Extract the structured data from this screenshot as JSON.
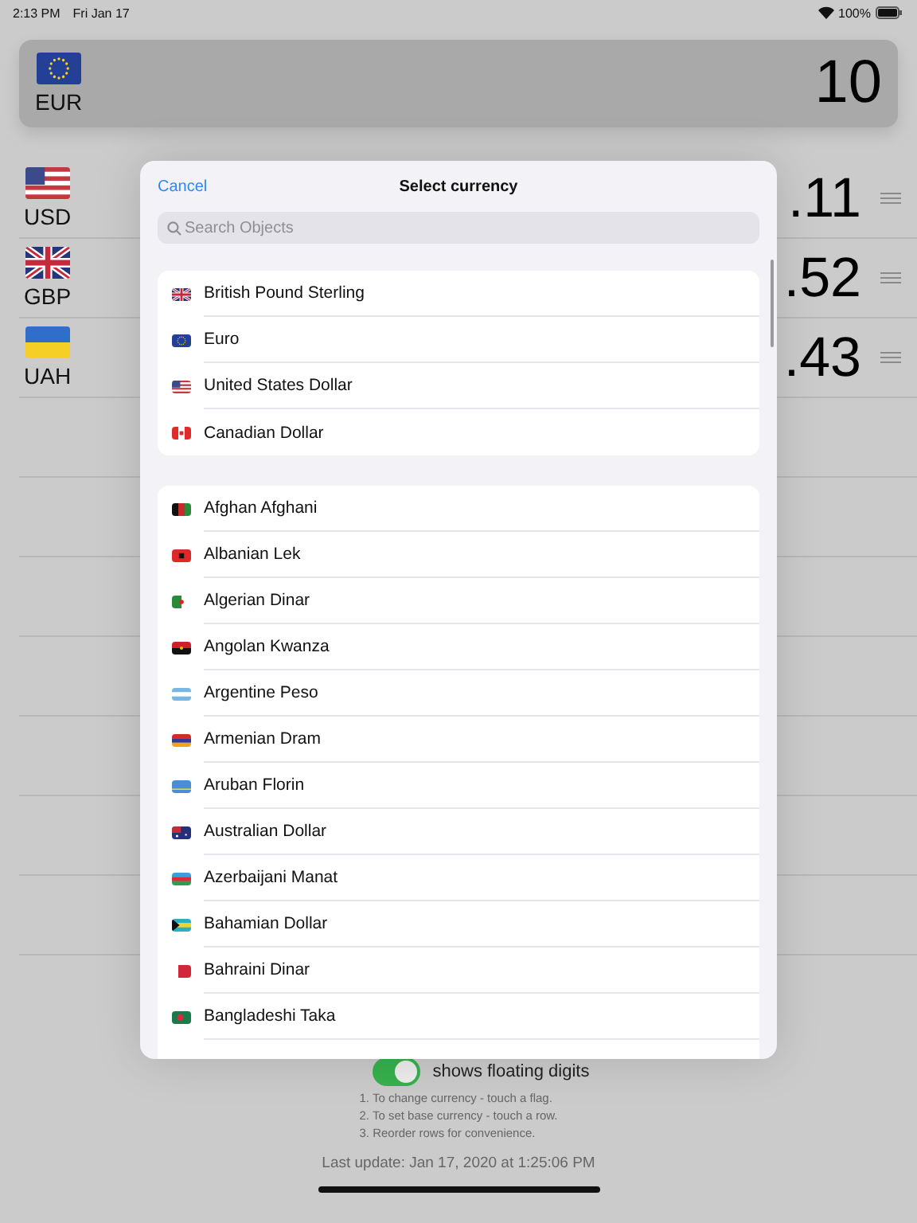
{
  "status_bar": {
    "time": "2:13 PM",
    "date": "Fri Jan 17",
    "battery": "100%"
  },
  "base_currency": {
    "code": "EUR",
    "amount": "10"
  },
  "rates": [
    {
      "code": "USD",
      "amount": ".11"
    },
    {
      "code": "GBP",
      "amount": ".52"
    },
    {
      "code": "UAH",
      "amount": ".43"
    }
  ],
  "picker": {
    "cancel": "Cancel",
    "title": "Select currency",
    "search": {
      "placeholder": "Search Objects"
    },
    "groups": [
      [
        "British Pound Sterling",
        "Euro",
        "United States Dollar",
        "Canadian Dollar"
      ],
      [
        "Afghan Afghani",
        "Albanian Lek",
        "Algerian Dinar",
        "Angolan Kwanza",
        "Argentine Peso",
        "Armenian Dram",
        "Aruban Florin",
        "Australian Dollar",
        "Azerbaijani Manat",
        "Bahamian Dollar",
        "Bahraini Dinar",
        "Bangladeshi Taka"
      ]
    ]
  },
  "floating_digits": {
    "label": "shows floating digits",
    "on": true
  },
  "instructions": [
    "1. To change currency - touch a flag.",
    "2. To set base currency - touch a row.",
    "3. Reorder rows for convenience."
  ],
  "last_update": "Last update: Jan 17, 2020 at 1:25:06 PM"
}
